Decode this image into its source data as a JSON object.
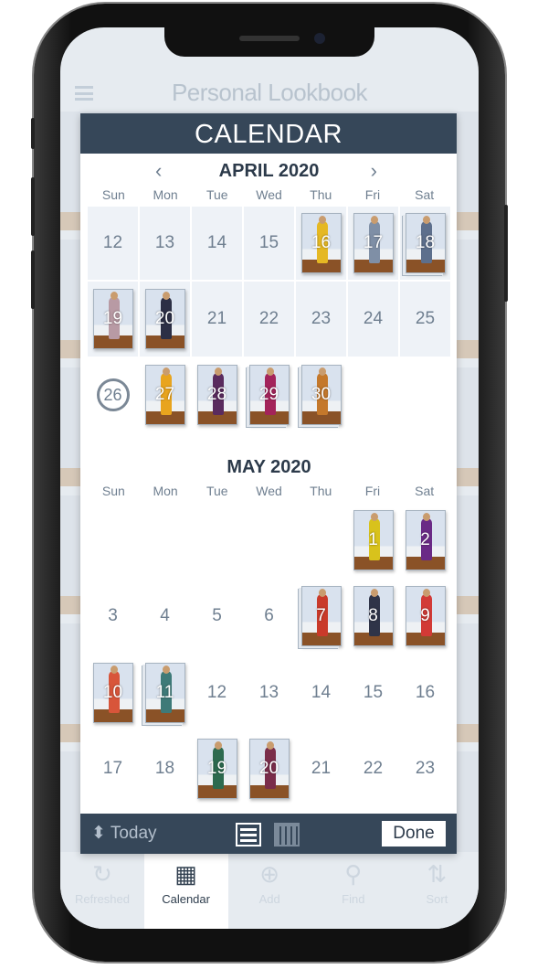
{
  "app": {
    "title": "Personal Lookbook"
  },
  "modal": {
    "title": "CALENDAR"
  },
  "weekdays": [
    "Sun",
    "Mon",
    "Tue",
    "Wed",
    "Thu",
    "Fri",
    "Sat"
  ],
  "months": [
    {
      "title": "APRIL 2020",
      "nav": true,
      "weeks": [
        [
          {
            "d": "12",
            "past": true
          },
          {
            "d": "13",
            "past": true
          },
          {
            "d": "14",
            "past": true
          },
          {
            "d": "15",
            "past": true
          },
          {
            "d": "16",
            "past": true,
            "photo": "#e5b823"
          },
          {
            "d": "17",
            "past": true,
            "photo": "#7f8fa6"
          },
          {
            "d": "18",
            "past": true,
            "photo": "#5d6f8c",
            "stack": true
          }
        ],
        [
          {
            "d": "19",
            "past": true,
            "photo": "#b89aa4"
          },
          {
            "d": "20",
            "past": true,
            "photo": "#2c2f45"
          },
          {
            "d": "21",
            "past": true
          },
          {
            "d": "22",
            "past": true
          },
          {
            "d": "23",
            "past": true
          },
          {
            "d": "24",
            "past": true
          },
          {
            "d": "25",
            "past": true
          }
        ],
        [
          {
            "d": "26",
            "today": true
          },
          {
            "d": "27",
            "photo": "#e8a41e"
          },
          {
            "d": "28",
            "photo": "#5a2b5e"
          },
          {
            "d": "29",
            "photo": "#a3245a",
            "stack": true
          },
          {
            "d": "30",
            "photo": "#c4782b",
            "stack": true
          },
          null,
          null
        ]
      ]
    },
    {
      "title": "MAY 2020",
      "weeks": [
        [
          null,
          null,
          null,
          null,
          null,
          {
            "d": "1",
            "photo": "#d8c21c"
          },
          {
            "d": "2",
            "photo": "#6a2a86"
          }
        ],
        [
          {
            "d": "3"
          },
          {
            "d": "4"
          },
          {
            "d": "5"
          },
          {
            "d": "6"
          },
          {
            "d": "7",
            "photo": "#c93a2a",
            "stack": true
          },
          {
            "d": "8",
            "photo": "#2f3448"
          },
          {
            "d": "9",
            "photo": "#d23a36"
          }
        ],
        [
          {
            "d": "10",
            "photo": "#d8553a"
          },
          {
            "d": "11",
            "photo": "#3e7a78",
            "stack": true
          },
          {
            "d": "12"
          },
          {
            "d": "13"
          },
          {
            "d": "14"
          },
          {
            "d": "15"
          },
          {
            "d": "16"
          }
        ],
        [
          {
            "d": "17"
          },
          {
            "d": "18"
          },
          {
            "d": "19",
            "photo": "#2d6a4f"
          },
          {
            "d": "20",
            "photo": "#7a2d4a"
          },
          {
            "d": "21"
          },
          {
            "d": "22"
          },
          {
            "d": "23"
          }
        ]
      ]
    }
  ],
  "footer": {
    "today_label": "Today",
    "today_icon": "up-down-chevron-icon",
    "done_label": "Done"
  },
  "tabs": [
    {
      "label": "Refreshed",
      "icon": "refresh-icon",
      "glyph": "↻"
    },
    {
      "label": "Calendar",
      "icon": "calendar-icon",
      "glyph": "▦",
      "active": true
    },
    {
      "label": "Add",
      "icon": "plus-circle-icon",
      "glyph": "⊕"
    },
    {
      "label": "Find",
      "icon": "search-icon",
      "glyph": "⚲"
    },
    {
      "label": "Sort",
      "icon": "sort-icon",
      "glyph": "⇅"
    }
  ],
  "colors": {
    "header": "#364759",
    "past_cell": "#eef2f7",
    "text_muted": "#6f7f90"
  }
}
